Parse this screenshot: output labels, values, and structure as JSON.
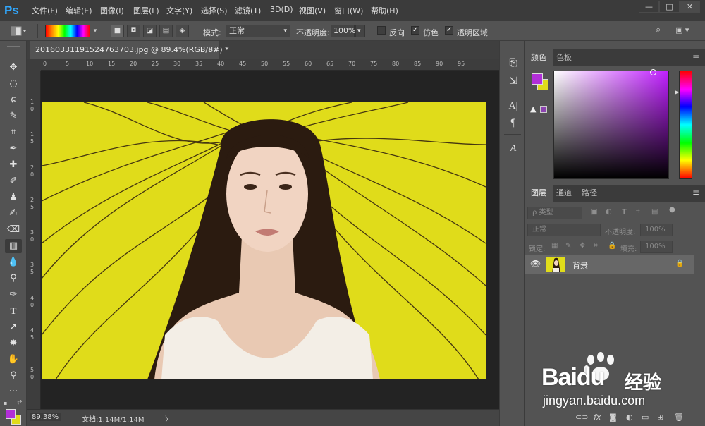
{
  "app": {
    "logo": "Ps",
    "menu": [
      "文件(F)",
      "编辑(E)",
      "图像(I)",
      "图层(L)",
      "文字(Y)",
      "选择(S)",
      "滤镜(T)",
      "3D(D)",
      "视图(V)",
      "窗口(W)",
      "帮助(H)"
    ],
    "window_buttons": [
      "—",
      "□",
      "✕"
    ]
  },
  "options": {
    "mode_label": "模式:",
    "mode_value": "正常",
    "opacity_label": "不透明度:",
    "opacity_value": "100%",
    "reverse_label": "反向",
    "reverse_checked": false,
    "dither_label": "仿色",
    "dither_checked": true,
    "transparency_label": "透明区域",
    "transparency_checked": true
  },
  "document": {
    "tab_title": "20160331191524763703.jpg @ 89.4%(RGB/8#) *",
    "close_glyph": "✕",
    "ruler_h": [
      "0",
      "5",
      "10",
      "15",
      "20",
      "25",
      "30",
      "35",
      "40",
      "45",
      "50",
      "55",
      "60",
      "65",
      "70",
      "75",
      "80",
      "85",
      "90",
      "95"
    ],
    "ruler_v": [
      "1",
      "0",
      "1",
      "5",
      "2",
      "0",
      "2",
      "5",
      "3",
      "0",
      "3",
      "5",
      "4",
      "0",
      "4",
      "5",
      "5",
      "0"
    ],
    "zoom": "89.38%",
    "doc_info": "文档:1.14M/1.14M",
    "status_arrow": "〉"
  },
  "color_panel": {
    "tabs": [
      "颜色",
      "色板"
    ],
    "foreground": "#b22fd8",
    "background": "#e0dc1a",
    "field_hue": "#c01fff"
  },
  "layers_panel": {
    "tabs": [
      "图层",
      "通道",
      "路径"
    ],
    "filter_label": "ρ 类型",
    "blend_mode": "正常",
    "opacity_label": "不透明度:",
    "opacity_value": "100%",
    "lock_label": "锁定:",
    "fill_label": "填充:",
    "fill_value": "100%",
    "layer_name": "背景"
  },
  "watermark": {
    "brand": "Baidu",
    "brand_cn": "经验",
    "url": "jingyan.baidu.com"
  },
  "colors": {
    "ui_dark": "#3b3b3b",
    "ui_mid": "#535353",
    "image_bg": "#e0dc1a",
    "accent": "#31a8ff"
  }
}
